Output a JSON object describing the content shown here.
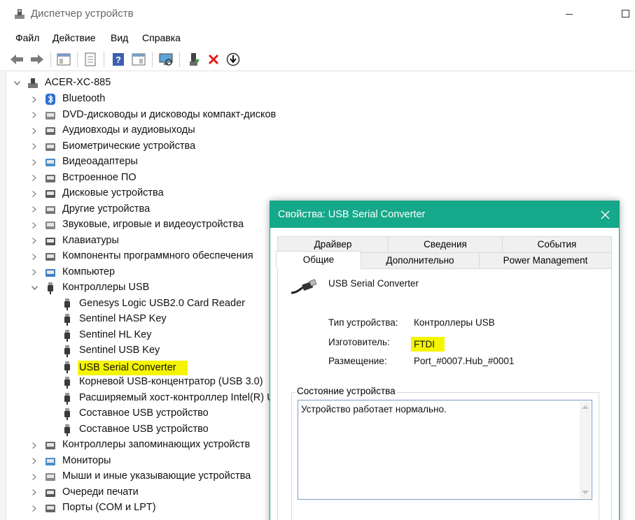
{
  "window": {
    "title": "Диспетчер устройств"
  },
  "menu": [
    "Файл",
    "Действие",
    "Вид",
    "Справка"
  ],
  "tree": {
    "root": "ACER-XC-885",
    "categories": [
      "Bluetooth",
      "DVD-дисководы и дисководы компакт-дисков",
      "Аудиовходы и аудиовыходы",
      "Биометрические устройства",
      "Видеоадаптеры",
      "Встроенное ПО",
      "Дисковые устройства",
      "Другие устройства",
      "Звуковые, игровые и видеоустройства",
      "Клавиатуры",
      "Компоненты программного обеспечения",
      "Компьютер",
      "Контроллеры USB"
    ],
    "usb_children": [
      "Genesys Logic USB2.0 Card Reader",
      "Sentinel HASP Key",
      "Sentinel HL Key",
      "Sentinel USB Key",
      "USB Serial Converter",
      "Корневой USB-концентратор (USB 3.0)",
      "Расширяемый хост-контроллер Intel(R) U",
      "Составное USB устройство",
      "Составное USB устройство"
    ],
    "categories_after": [
      "Контроллеры запоминающих устройств",
      "Мониторы",
      "Мыши и иные указывающие устройства",
      "Очереди печати",
      "Порты (COM и LPT)"
    ]
  },
  "dialog": {
    "title": "Свойства: USB Serial Converter",
    "tabs_top": [
      "Драйвер",
      "Сведения",
      "События"
    ],
    "tabs_bottom": [
      "Общие",
      "Дополнительно",
      "Power Management"
    ],
    "device_name": "USB Serial Converter",
    "props": {
      "type_label": "Тип устройства:",
      "type_value": "Контроллеры USB",
      "mfr_label": "Изготовитель:",
      "mfr_value": "FTDI",
      "loc_label": "Размещение:",
      "loc_value": "Port_#0007.Hub_#0001"
    },
    "status_group": "Состояние устройства",
    "status_text": "Устройство работает нормально."
  },
  "colors": {
    "accent": "#16a88a",
    "highlight": "#f6f500"
  }
}
